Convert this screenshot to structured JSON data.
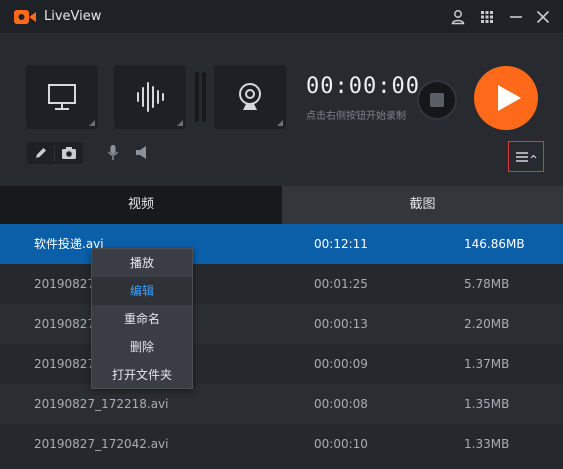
{
  "app": {
    "title": "LiveView"
  },
  "recorder": {
    "timer": "00:00:00",
    "hint": "点击右侧按钮开始录制"
  },
  "tabs": [
    {
      "label": "视频",
      "active": true
    },
    {
      "label": "截图",
      "active": false
    }
  ],
  "files": [
    {
      "name": "软件投递.avi",
      "duration": "00:12:11",
      "size": "146.86MB",
      "selected": true
    },
    {
      "name": "20190827_",
      "duration": "00:01:25",
      "size": "5.78MB"
    },
    {
      "name": "20190827_",
      "duration": "00:00:13",
      "size": "2.20MB"
    },
    {
      "name": "20190827_",
      "duration": "00:00:09",
      "size": "1.37MB"
    },
    {
      "name": "20190827_172218.avi",
      "duration": "00:00:08",
      "size": "1.35MB"
    },
    {
      "name": "20190827_172042.avi",
      "duration": "00:00:10",
      "size": "1.33MB"
    }
  ],
  "context_menu": {
    "items": [
      "播放",
      "编辑",
      "重命名",
      "删除",
      "打开文件夹"
    ],
    "highlighted": "编辑"
  },
  "colors": {
    "accent": "#ff6a1a",
    "selection": "#0b5ea8",
    "menu_highlight_text": "#3ea0ff",
    "menu_toggle_border": "#d63a3a"
  },
  "icons": {
    "logo": "camera-logo-icon",
    "titlebar": [
      "user-icon",
      "grid-icon",
      "minimize-icon",
      "close-icon"
    ],
    "sources": [
      "monitor-icon",
      "audio-wave-icon",
      "webcam-icon"
    ],
    "tools": [
      "pencil-icon",
      "camera-icon",
      "microphone-icon",
      "speaker-icon"
    ],
    "menu": "hamburger-menu-icon"
  }
}
